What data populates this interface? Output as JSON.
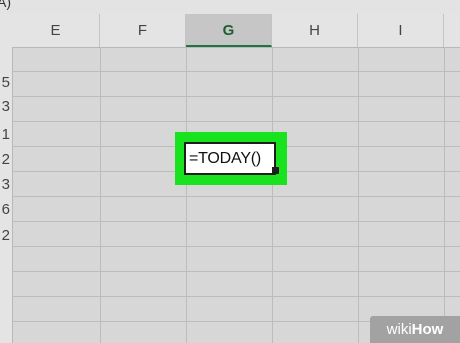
{
  "window": {
    "top_fragment": "A)"
  },
  "columns": [
    "E",
    "F",
    "G",
    "H",
    "I"
  ],
  "selected_column": "G",
  "row_tail_digits": [
    "5",
    "3",
    "1",
    "2",
    "3",
    "6",
    "2"
  ],
  "active_cell": {
    "formula": "=TODAY()"
  },
  "watermark": {
    "prefix": "wiki",
    "suffix": "How"
  },
  "colors": {
    "highlight": "#19e31f",
    "grid": "#bcbcbc",
    "selected_header_text": "#1d5e33"
  }
}
